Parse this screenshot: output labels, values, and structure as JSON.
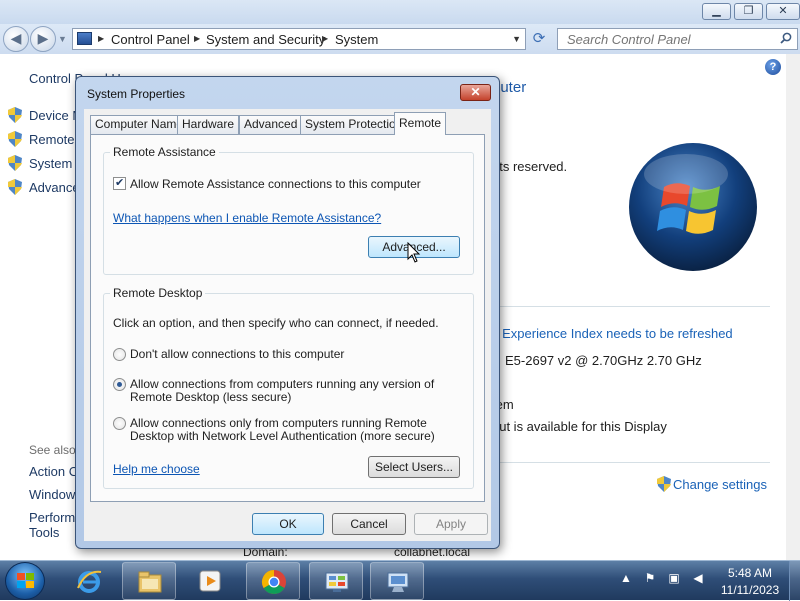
{
  "explorer": {
    "breadcrumb": [
      "Control Panel",
      "System and Security",
      "System"
    ],
    "search_placeholder": "Search Control Panel"
  },
  "left_pane": {
    "home": "Control Panel Home",
    "items": [
      "Device Manager",
      "Remote settings",
      "System protection",
      "Advanced system settings"
    ],
    "see_also": "See also",
    "see_also_links": [
      "Action Center",
      "Windows Update",
      "Performance Information and",
      "Tools"
    ]
  },
  "content": {
    "heading_fragment": "puter",
    "rights_fragment": "nts reserved.",
    "wei_fragment": "s Experience Index needs to be refreshed",
    "processor_fragment": "E5-2697 v2 @ 2.70GHz   2.70 GHz",
    "system_type_fragment": "tem",
    "pen_touch_fragment": "but is available for this Display",
    "change_settings": "Change settings",
    "domain_label": "Domain:",
    "domain_value": "collabnet.local"
  },
  "dialog": {
    "title": "System Properties",
    "close_glyph": "✕",
    "tabs": [
      {
        "label": "Computer Name",
        "active": false
      },
      {
        "label": "Hardware",
        "active": false
      },
      {
        "label": "Advanced",
        "active": false
      },
      {
        "label": "System Protection",
        "active": false
      },
      {
        "label": "Remote",
        "active": true
      }
    ],
    "remote_assistance": {
      "title": "Remote Assistance",
      "allow_label": "Allow Remote Assistance connections to this computer",
      "allow_checked": true,
      "help_link": "What happens when I enable Remote Assistance?",
      "advanced_button": "Advanced..."
    },
    "remote_desktop": {
      "title": "Remote Desktop",
      "instruction": "Click an option, and then specify who can connect, if needed.",
      "options": [
        {
          "line1": "Don't allow connections to this computer",
          "line2": "",
          "selected": false
        },
        {
          "line1": "Allow connections from computers running any version of",
          "line2": "Remote Desktop (less secure)",
          "selected": true
        },
        {
          "line1": "Allow connections only from computers running Remote",
          "line2": "Desktop with Network Level Authentication (more secure)",
          "selected": false
        }
      ],
      "help_link": "Help me choose",
      "select_users_button": "Select Users..."
    },
    "ok_button": "OK",
    "cancel_button": "Cancel",
    "apply_button": "Apply"
  },
  "taskbar": {
    "time": "5:48 AM",
    "date": "11/11/2023",
    "apps": [
      "start-orb",
      "internet-explorer-icon",
      "file-explorer-icon",
      "media-player-icon",
      "chrome-icon",
      "control-panel-icon",
      "system-properties-icon"
    ]
  }
}
